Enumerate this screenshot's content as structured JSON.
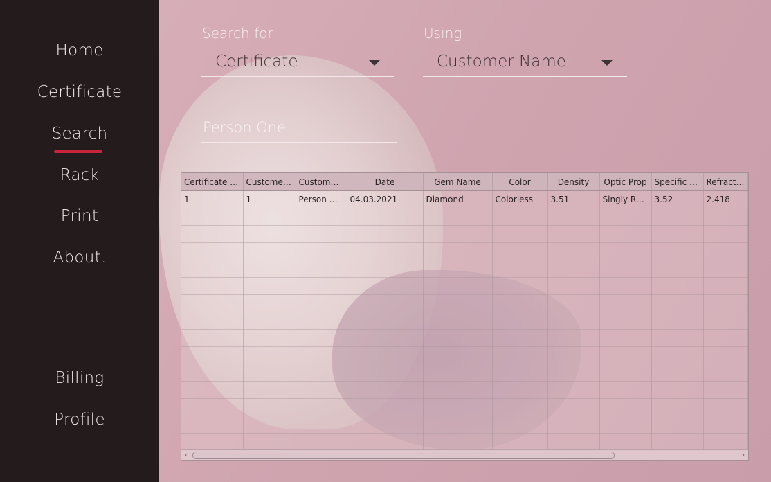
{
  "sidebar": {
    "items": [
      {
        "label": "Home"
      },
      {
        "label": "Certificate"
      },
      {
        "label": "Search",
        "active": true
      },
      {
        "label": "Rack"
      },
      {
        "label": "Print"
      },
      {
        "label": "About."
      },
      {
        "label": "Billing"
      },
      {
        "label": "Profile"
      }
    ],
    "accent_color": "#c8243b"
  },
  "search": {
    "search_for_label": "Search for",
    "search_for_value": "Certificate",
    "using_label": "Using",
    "using_value": "Customer Name",
    "query_value": "Person One"
  },
  "table": {
    "columns": [
      "Certificate No",
      "Customer ID",
      "Customer ...",
      "Date",
      "Gem Name",
      "Color",
      "Density",
      "Optic Prop",
      "Specific G...",
      "Refractive"
    ],
    "rows": [
      [
        "1",
        "1",
        "Person One",
        "04.03.2021",
        "Diamond",
        "Colorless",
        "3.51",
        "Singly Ref...",
        "3.52",
        "2.418"
      ]
    ],
    "empty_rows": 14
  },
  "icons": {
    "dropdown": "chevron-down-icon",
    "scroll_left": "arrow-left-icon",
    "scroll_right": "arrow-right-icon"
  }
}
